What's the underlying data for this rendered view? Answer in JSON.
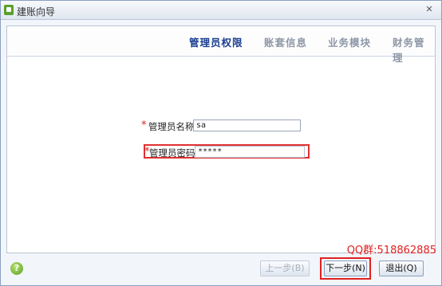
{
  "window": {
    "title": "建账向导",
    "close_label": "✕"
  },
  "steps": [
    {
      "label": "管理员权限",
      "active": true
    },
    {
      "label": "账套信息",
      "active": false
    },
    {
      "label": "业务模块",
      "active": false
    },
    {
      "label": "财务管理",
      "active": false
    }
  ],
  "form": {
    "admin_name": {
      "label": "管理员名称",
      "required_mark": "*",
      "value": "sa"
    },
    "admin_password": {
      "label": "管理员密码",
      "required_mark": "*",
      "value": "*****"
    }
  },
  "watermark": "QQ群:518862885",
  "buttons": {
    "help": "?",
    "prev": "上一步(B)",
    "next": "下一步(N)",
    "exit": "退出(Q)"
  }
}
